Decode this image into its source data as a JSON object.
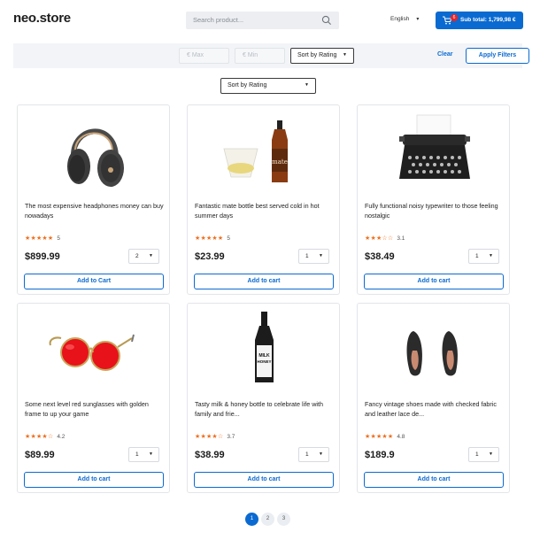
{
  "header": {
    "logo": "neo.store",
    "search_placeholder": "Search product...",
    "language": "English",
    "cart_count": "6",
    "subtotal": "Sub total: 1,799,98 €"
  },
  "filters": {
    "max_placeholder": "€ Max",
    "min_placeholder": "€ Min",
    "sort_selected": "Sort by Rating",
    "clear_label": "Clear",
    "apply_label": "Apply Filters",
    "sort2_selected": "Sort by Rating"
  },
  "products": [
    {
      "title": "The most expensive headphones money can buy nowadays",
      "stars": "★★★★★",
      "rating": "5",
      "price": "$899.99",
      "qty": "2",
      "button": "Add to Cart"
    },
    {
      "title": "Fantastic mate bottle best served cold in hot summer days",
      "stars": "★★★★★",
      "rating": "5",
      "price": "$23.99",
      "qty": "1",
      "button": "Add to cart"
    },
    {
      "title": "Fully functional noisy typewriter to those feeling nostalgic",
      "stars": "★★★☆☆",
      "rating": "3.1",
      "price": "$38.49",
      "qty": "1",
      "button": "Add to cart"
    },
    {
      "title": "Some next level red sunglasses with golden frame to up your game",
      "stars": "★★★★☆",
      "rating": "4.2",
      "price": "$89.99",
      "qty": "1",
      "button": "Add to cart"
    },
    {
      "title": "Tasty milk & honey bottle to celebrate life with family and frie...",
      "stars": "★★★★☆",
      "rating": "3.7",
      "price": "$38.99",
      "qty": "1",
      "button": "Add to cart"
    },
    {
      "title": "Fancy vintage shoes made with checked fabric and leather lace de...",
      "stars": "★★★★★",
      "rating": "4.8",
      "price": "$189.9",
      "qty": "1",
      "button": "Add to cart"
    }
  ],
  "bottle_labels": {
    "mate": "mate",
    "milk": "MILK",
    "honey": "HONEY"
  },
  "pagination": [
    "1",
    "2",
    "3"
  ],
  "colors": {
    "primary": "#0b6ad1",
    "star": "#ef6f1f",
    "badge": "#e22222"
  }
}
